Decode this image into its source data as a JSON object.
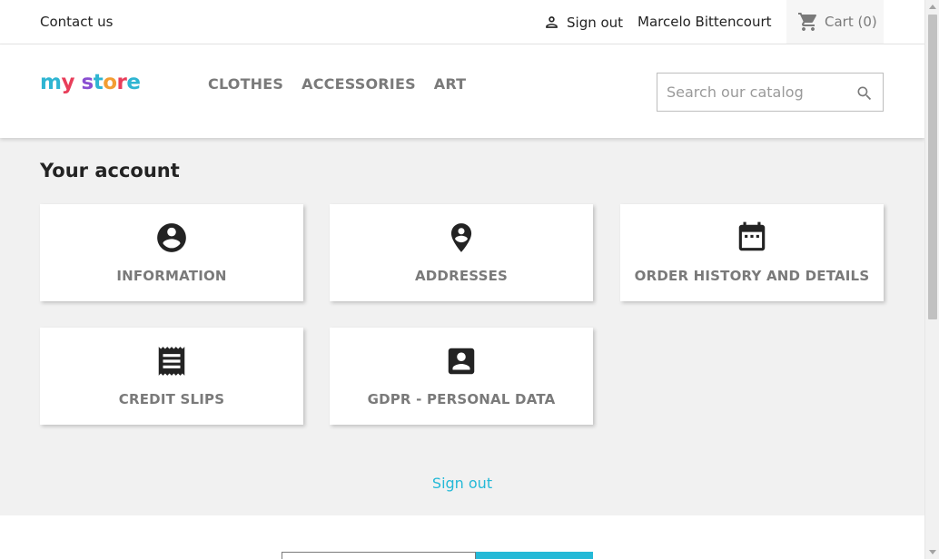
{
  "topbar": {
    "contact_label": "Contact us",
    "signout_label": "Sign out",
    "user_name": "Marcelo Bittencourt",
    "cart_label": "Cart (0)"
  },
  "header": {
    "logo_parts": [
      "m",
      "y",
      " ",
      "s",
      "t",
      "o",
      "r",
      "e"
    ],
    "logo_text": "my store",
    "menu": [
      "CLOTHES",
      "ACCESSORIES",
      "ART"
    ],
    "search_placeholder": "Search our catalog"
  },
  "main": {
    "title": "Your account",
    "cards": [
      {
        "label": "INFORMATION",
        "icon": "account-circle-icon"
      },
      {
        "label": "ADDRESSES",
        "icon": "location-pin-icon"
      },
      {
        "label": "ORDER HISTORY AND DETAILS",
        "icon": "calendar-icon"
      },
      {
        "label": "CREDIT SLIPS",
        "icon": "receipt-icon"
      },
      {
        "label": "GDPR - PERSONAL DATA",
        "icon": "account-box-icon"
      }
    ],
    "signout_label": "Sign out"
  },
  "colors": {
    "accent": "#24b9d7",
    "background": "#f1f1f1",
    "card_label": "#7a7a7a",
    "logo": [
      "#2fb5d2",
      "#e83e5a",
      "#f39d33",
      "#8a4fd1"
    ]
  }
}
